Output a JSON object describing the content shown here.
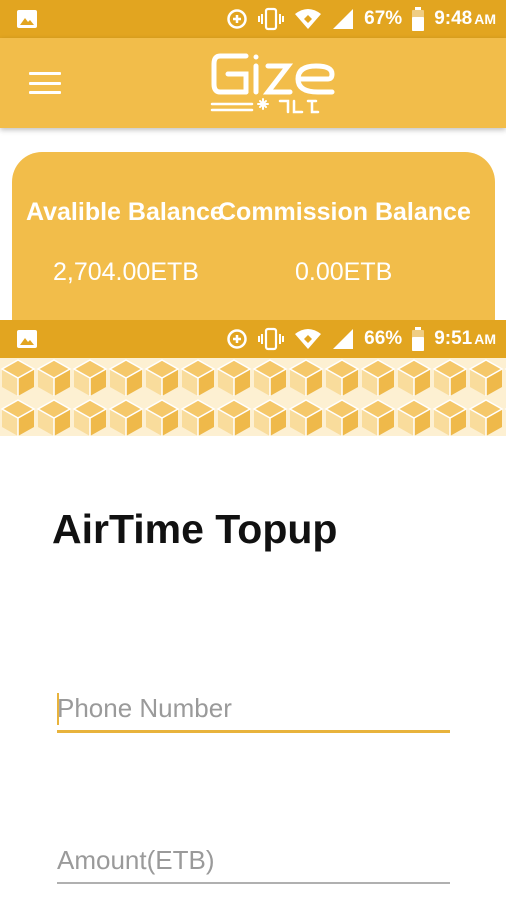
{
  "status_bar_top": {
    "battery": "67%",
    "time": "9:48",
    "time_suffix": "AM"
  },
  "status_bar_second": {
    "battery": "66%",
    "time": "9:51",
    "time_suffix": "AM"
  },
  "app": {
    "logo_alt": "Gize"
  },
  "balances": {
    "available_label": "Avalible Balance",
    "available_value": "2,704.00ETB",
    "commission_label": "Commission Balance",
    "commission_value": "0.00ETB"
  },
  "page": {
    "title": "AirTime Topup"
  },
  "form": {
    "phone_placeholder": "Phone Number",
    "amount_placeholder": "Amount(ETB)"
  },
  "colors": {
    "status_bar": "#e2a520",
    "app_bar": "#f2bd4a",
    "accent": "#e8b33c"
  }
}
